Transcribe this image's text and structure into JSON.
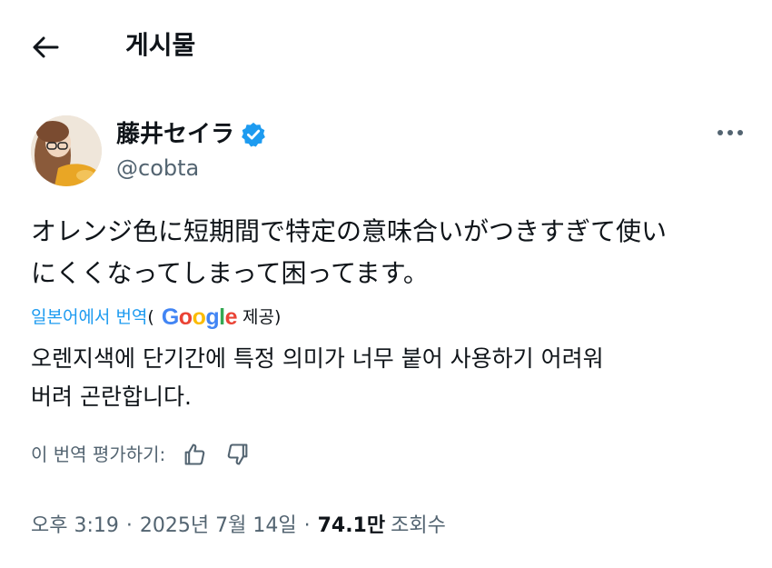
{
  "header": {
    "title": "게시물",
    "back_icon": "arrow-left-icon"
  },
  "author": {
    "display_name": "藤井セイラ",
    "handle": "@cobta",
    "verified": true,
    "verified_color": "#1d9bf0",
    "more_icon": "more-horizontal-icon"
  },
  "tweet": {
    "text_line1": "オレンジ色に短期間で特定の意味合いがつきすぎて使い",
    "text_line2": "にくくなってしまって困ってます。"
  },
  "translation": {
    "link_label": "일본어에서 번역",
    "open_paren": "(",
    "provider": "Google",
    "provided_label": "제공)",
    "text_line1": "오렌지색에 단기간에 특정 의미가 너무 붙어 사용하기 어려워",
    "text_line2": "버려 곤란합니다.",
    "rate_label": "이 번역 평가하기:",
    "thumbs_up_icon": "thumbs-up-icon",
    "thumbs_down_icon": "thumbs-down-icon"
  },
  "meta": {
    "time": "오후 3:19",
    "separator": "·",
    "date": "2025년 7월 14일",
    "views_count": "74.1만",
    "views_label": "조회수"
  },
  "colors": {
    "accent": "#1d9bf0",
    "text_primary": "#0f1419",
    "text_secondary": "#536471",
    "google_blue": "#4285F4",
    "google_red": "#EA4335",
    "google_yellow": "#FBBC05",
    "google_green": "#34A853"
  }
}
